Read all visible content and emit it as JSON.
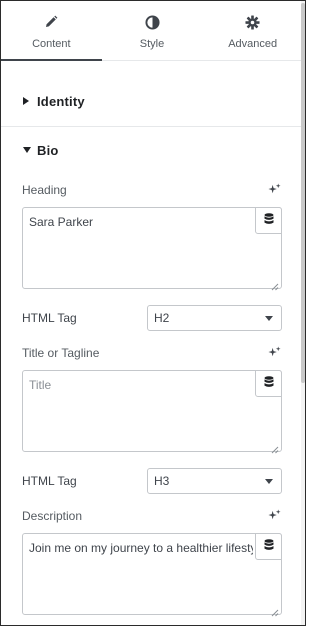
{
  "tabs": [
    {
      "label": "Content",
      "icon": "pencil-icon",
      "active": true
    },
    {
      "label": "Style",
      "icon": "half-circle-icon",
      "active": false
    },
    {
      "label": "Advanced",
      "icon": "gear-icon",
      "active": false
    }
  ],
  "sections": {
    "identity": {
      "title": "Identity",
      "expanded": false
    },
    "bio": {
      "title": "Bio",
      "expanded": true
    }
  },
  "bio": {
    "heading": {
      "label": "Heading",
      "value": "Sara Parker",
      "placeholder": ""
    },
    "heading_tag": {
      "label": "HTML Tag",
      "value": "H2"
    },
    "tagline": {
      "label": "Title or Tagline",
      "value": "",
      "placeholder": "Title"
    },
    "tagline_tag": {
      "label": "HTML Tag",
      "value": "H3"
    },
    "description": {
      "label": "Description",
      "value": "Join me on my journey to a healthier lifestyle"
    }
  },
  "colors": {
    "text": "#3f444b",
    "border": "#c4c7cb",
    "divider": "#e6e8ea"
  }
}
